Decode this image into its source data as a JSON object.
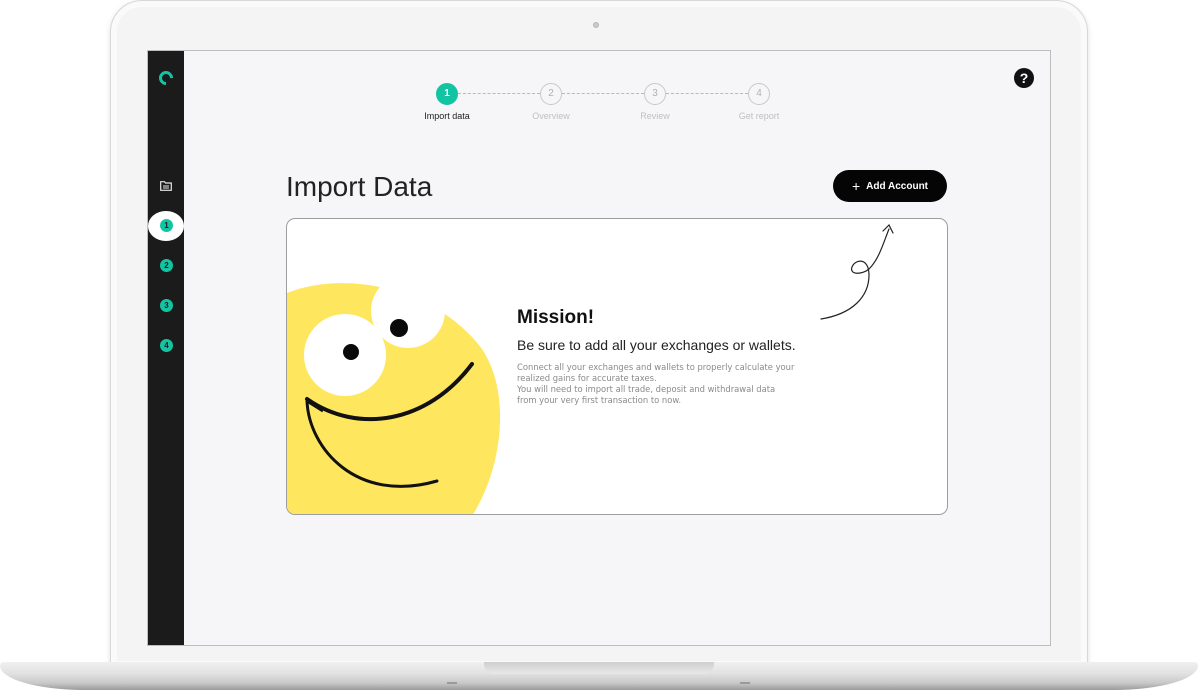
{
  "sidebar": {
    "logo": "C",
    "folder_icon": "folder-icon",
    "steps": [
      "1",
      "2",
      "3",
      "4"
    ],
    "active_step": 1
  },
  "stepper": {
    "steps": [
      {
        "number": "1",
        "label": "Import data",
        "active": true
      },
      {
        "number": "2",
        "label": "Overview",
        "active": false
      },
      {
        "number": "3",
        "label": "Review",
        "active": false
      },
      {
        "number": "4",
        "label": "Get report",
        "active": false
      }
    ]
  },
  "help": {
    "icon": "help-icon",
    "label": "?"
  },
  "page": {
    "title": "Import Data",
    "add_button": "Add Account",
    "add_button_icon": "+"
  },
  "card": {
    "title": "Mission!",
    "subtitle": "Be sure to add all your exchanges or wallets.",
    "body_lines": [
      "Connect all your exchanges and wallets to properly calculate your",
      "realized gains for accurate taxes.",
      "You will need to import all trade, deposit and withdrawal data",
      "from your very first transaction to now."
    ]
  },
  "colors": {
    "accent": "#13c4a3",
    "sidebar_bg": "#1b1b1b",
    "button_bg": "#050505",
    "mascot_yellow": "#ffe65f"
  }
}
